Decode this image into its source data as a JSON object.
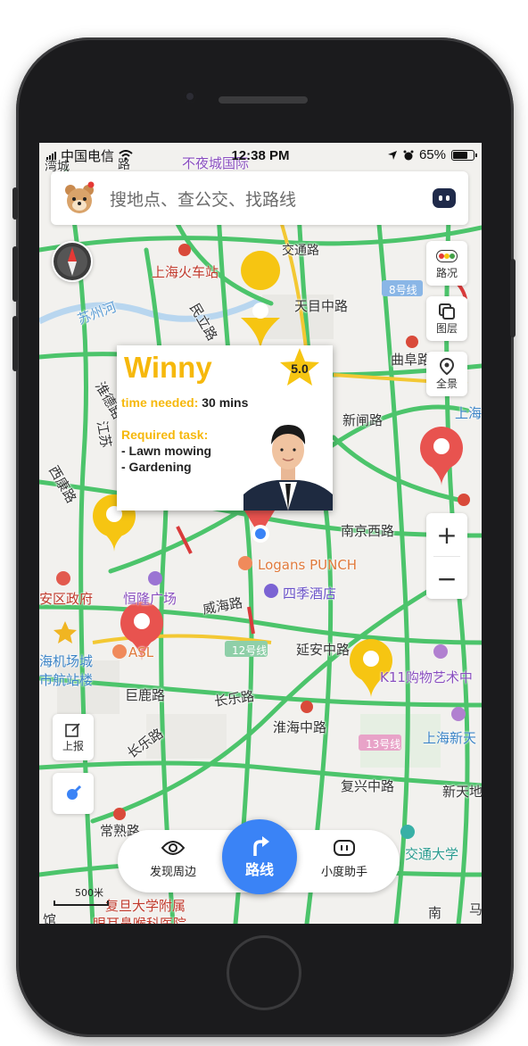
{
  "status_bar": {
    "carrier": "中国电信",
    "time": "12:38 PM",
    "battery_pct": "65%"
  },
  "search": {
    "placeholder": "搜地点、查公交、找路线"
  },
  "map_tools": {
    "traffic": "路况",
    "layers": "图层",
    "panorama": "全景",
    "report": "上报",
    "zoom_in": "+",
    "zoom_out": "−"
  },
  "map_labels": {
    "top_left": "湾城",
    "top_road": "路",
    "top_center": "不夜城国际",
    "jiaotong_rd": "交通路",
    "shanghai_station": "上海火车站",
    "tianmu_rd": "天目中路",
    "line8": "8号线",
    "suzhou_river": "苏州河",
    "minli_rd": "民立路",
    "qufu_rd": "曲阜路",
    "huaide_rd": "淮德路",
    "jiangsu": "江苏",
    "xinzha_rd": "新闸路",
    "shanghai_edge": "上海",
    "xikang_rd": "西康路",
    "nanjing_w_rd": "南京西路",
    "logans_punch": "Logans PUNCH",
    "four_seasons": "四季酒店",
    "district_gov": "安区政府",
    "henglong_plaza": "恒隆广场",
    "weihai_rd": "威海路",
    "airport_bldg_1": "海机场城",
    "airport_bldg_2": "市航站楼",
    "asl": "ASL",
    "line12": "12号线",
    "yanan_rd": "延安中路",
    "k11": "K11购物艺术中",
    "julu_rd": "巨鹿路",
    "changle_rd": "长乐路",
    "huaihai_rd": "淮海中路",
    "changle_rd2": "长乐路",
    "line13": "13号线",
    "xintiandi": "上海新天",
    "fuxing_rd": "复兴中路",
    "xintiandi2": "新天地",
    "changshu_rd": "常熟路",
    "jiaotong_univ": "交通大学",
    "fudan_affil": "复旦大学附属",
    "hospital": "眼耳鼻喉科医院",
    "nan": "南",
    "ma": "马",
    "guan": "馆"
  },
  "card": {
    "name": "Winny",
    "rating": "5.0",
    "time_label": "time needed:",
    "time_value": "30 mins",
    "required_label": "Required task:",
    "tasks": [
      "- Lawn mowing",
      "- Gardening"
    ]
  },
  "bottom_nav": {
    "discover": "发现周边",
    "route": "路线",
    "assistant": "小度助手"
  },
  "scale_label": "500米",
  "colors": {
    "accent_yellow": "#f6b80c",
    "route_blue": "#3a83f6",
    "road_green": "#4cc46b",
    "pin_red": "#e8534f",
    "pin_yellow": "#f6c512"
  },
  "icons": [
    "wifi-icon",
    "location-arrow-icon",
    "alarm-icon",
    "battery-icon",
    "bear-avatar-icon",
    "robot-icon",
    "compass-icon",
    "traffic-light-icon",
    "layers-icon",
    "panorama-pin-icon",
    "edit-icon",
    "locate-icon",
    "eye-icon",
    "turn-arrow-icon",
    "robot-face-icon",
    "star-icon"
  ]
}
